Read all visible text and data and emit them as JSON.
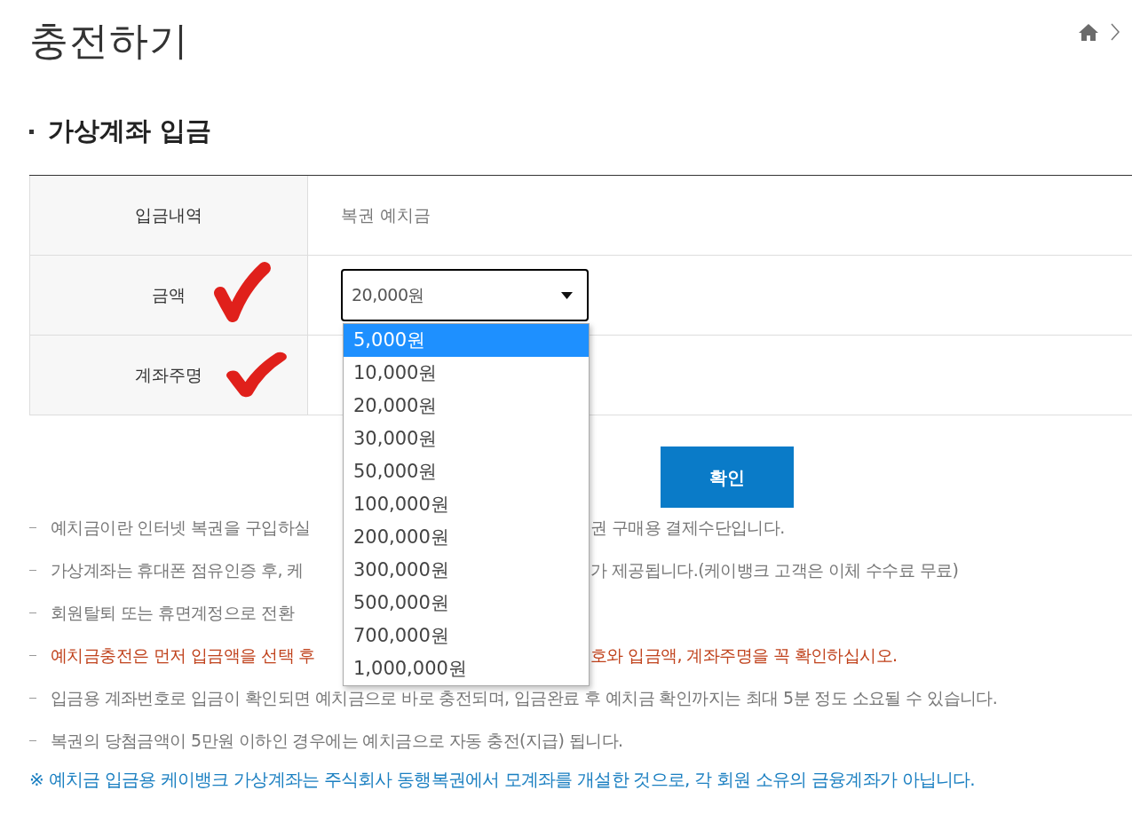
{
  "page_title": "충전하기",
  "section_title": "가상계좌 입금",
  "form": {
    "rows": [
      {
        "label": "입금내역",
        "kind": "text",
        "value": "복권 예치금",
        "check_mark": false
      },
      {
        "label": "금액",
        "kind": "select",
        "value": "20,000원",
        "expanded": true,
        "check_mark": true
      },
      {
        "label": "계좌주명",
        "kind": "empty",
        "check_mark": true
      }
    ]
  },
  "dropdown": {
    "options": [
      {
        "label": "5,000원",
        "selected": true
      },
      {
        "label": "10,000원",
        "selected": false
      },
      {
        "label": "20,000원",
        "selected": false
      },
      {
        "label": "30,000원",
        "selected": false
      },
      {
        "label": "50,000원",
        "selected": false
      },
      {
        "label": "100,000원",
        "selected": false
      },
      {
        "label": "200,000원",
        "selected": false
      },
      {
        "label": "300,000원",
        "selected": false
      },
      {
        "label": "500,000원",
        "selected": false
      },
      {
        "label": "700,000원",
        "selected": false
      },
      {
        "label": "1,000,000원",
        "selected": false
      }
    ]
  },
  "confirm_button": "확인",
  "notes": [
    {
      "kind": "normal",
      "head": "예치금이란 인터넷 복권을 구입하실",
      "tail": "권 구매용 결제수단입니다."
    },
    {
      "kind": "normal",
      "head": "가상계좌는 휴대폰 점유인증 후, 케",
      "tail": "가 제공됩니다.(케이뱅크 고객은 이체 수수료 무료)"
    },
    {
      "kind": "normal",
      "head": "회원탈퇴 또는 휴면계정으로 전환"
    },
    {
      "kind": "warning",
      "head": "예치금충전은 먼저 입금액을 선택 후",
      "tail": "호와 입금액, 계좌주명을 꼭 확인하십시오."
    },
    {
      "kind": "normal",
      "text": "입금용 계좌번호로 입금이 확인되면 예치금으로 바로 충전되며, 입금완료 후 예치금 확인까지는 최대 5분 정도 소요될 수 있습니다."
    },
    {
      "kind": "normal",
      "text": "복권의 당첨금액이 5만원 이하인 경우에는 예치금으로 자동 충전(지급) 됩니다."
    }
  ],
  "footnote": "※ 예치금 입금용 케이뱅크 가상계좌는 주식회사 동행복권에서 모계좌를 개설한 것으로, 각 회원 소유의 금융계좌가 아닙니다."
}
